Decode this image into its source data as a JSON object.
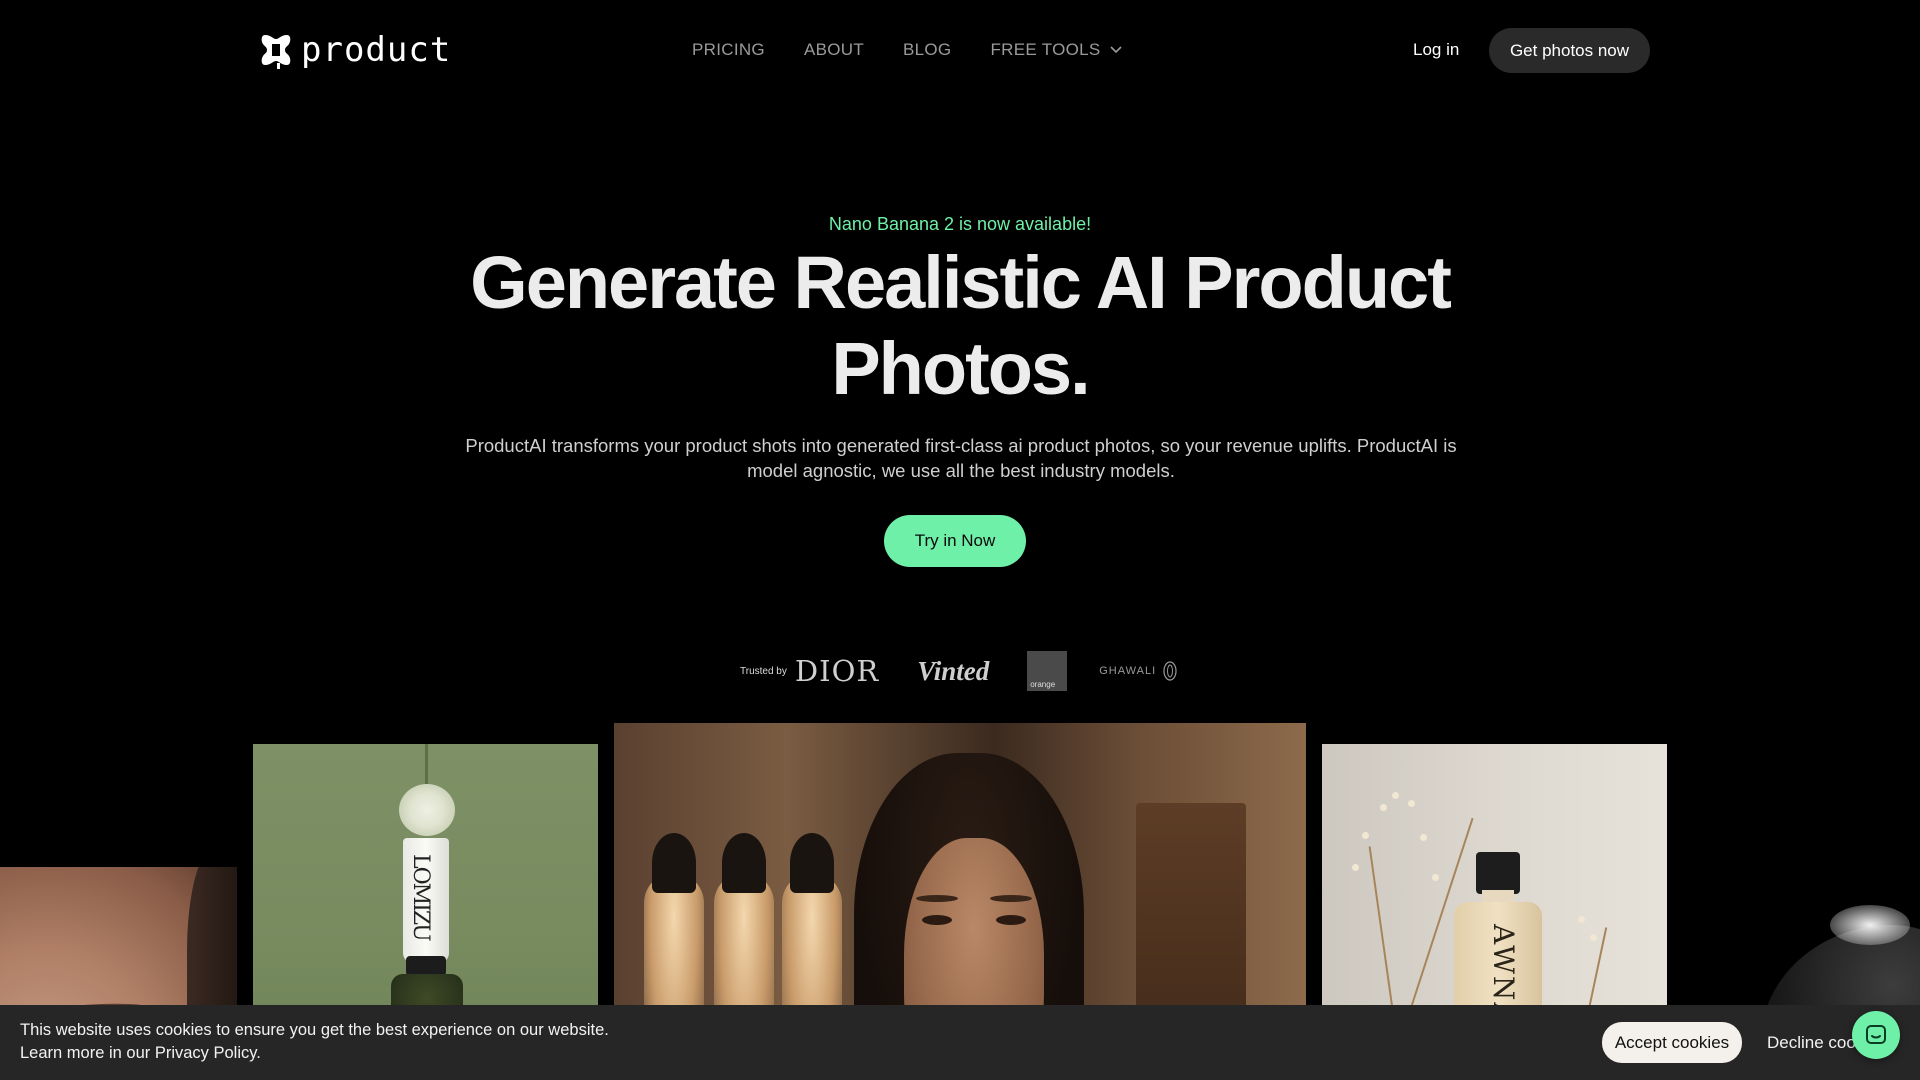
{
  "header": {
    "logo_text": "product",
    "nav": [
      "PRICING",
      "ABOUT",
      "BLOG",
      "FREE TOOLS"
    ],
    "login_label": "Log in",
    "cta_label": "Get photos now"
  },
  "hero": {
    "announcement": "Nano Banana 2 is now available!",
    "headline": "Generate Realistic AI Product Photos.",
    "subtext": "ProductAI transforms your product shots into generated first-class ai product photos, so your revenue uplifts. ProductAI is model agnostic, we use all the best industry models.",
    "cta_label": "Try in Now"
  },
  "trusted": {
    "label": "Trusted by",
    "brands": [
      "DIOR",
      "Vinted",
      "orange",
      "GHAWALI"
    ]
  },
  "gallery": {
    "tube_text": "LOMIZU",
    "bottle_text": "AWNA"
  },
  "cookies": {
    "line1": "This website uses cookies to ensure you get the best experience on our website.",
    "line2": "Learn more in our Privacy Policy.",
    "accept_label": "Accept cookies",
    "decline_label": "Decline cookies"
  },
  "colors": {
    "accent": "#6ef0a8",
    "background": "#000000",
    "cookie_bar": "#262626"
  }
}
